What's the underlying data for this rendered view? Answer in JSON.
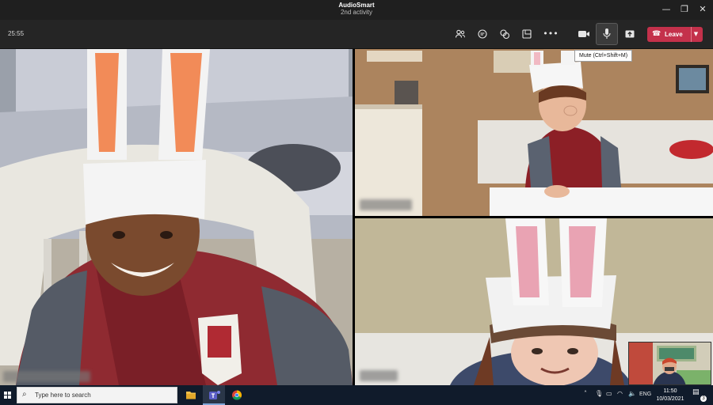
{
  "titlebar": {
    "app_brand": "AudioSmart",
    "title_sub": "2nd activity",
    "minimize_glyph": "—",
    "maximize_glyph": "❐",
    "close_glyph": "✕"
  },
  "meeting": {
    "timer": "25:55",
    "toolbar": {
      "participants_icon": "people-icon",
      "chat_icon": "chat-icon",
      "reactions_icon": "reactions-icon",
      "rooms_icon": "breakout-rooms-icon",
      "more_icon": "more-icon",
      "camera_icon": "camera-icon",
      "mic_icon": "microphone-icon",
      "share_icon": "share-icon",
      "leave_label": "Leave"
    },
    "tooltip": "Mute (Ctrl+Shift+M)"
  },
  "taskbar": {
    "search_placeholder": "Type here to search",
    "tray_lang": "ENG",
    "time": "11:50",
    "date": "10/03/2021",
    "notification_count": "3"
  },
  "colors": {
    "leave_red": "#c4314b",
    "toolbar_bg": "#252525",
    "taskbar_bg": "#101b2b"
  }
}
